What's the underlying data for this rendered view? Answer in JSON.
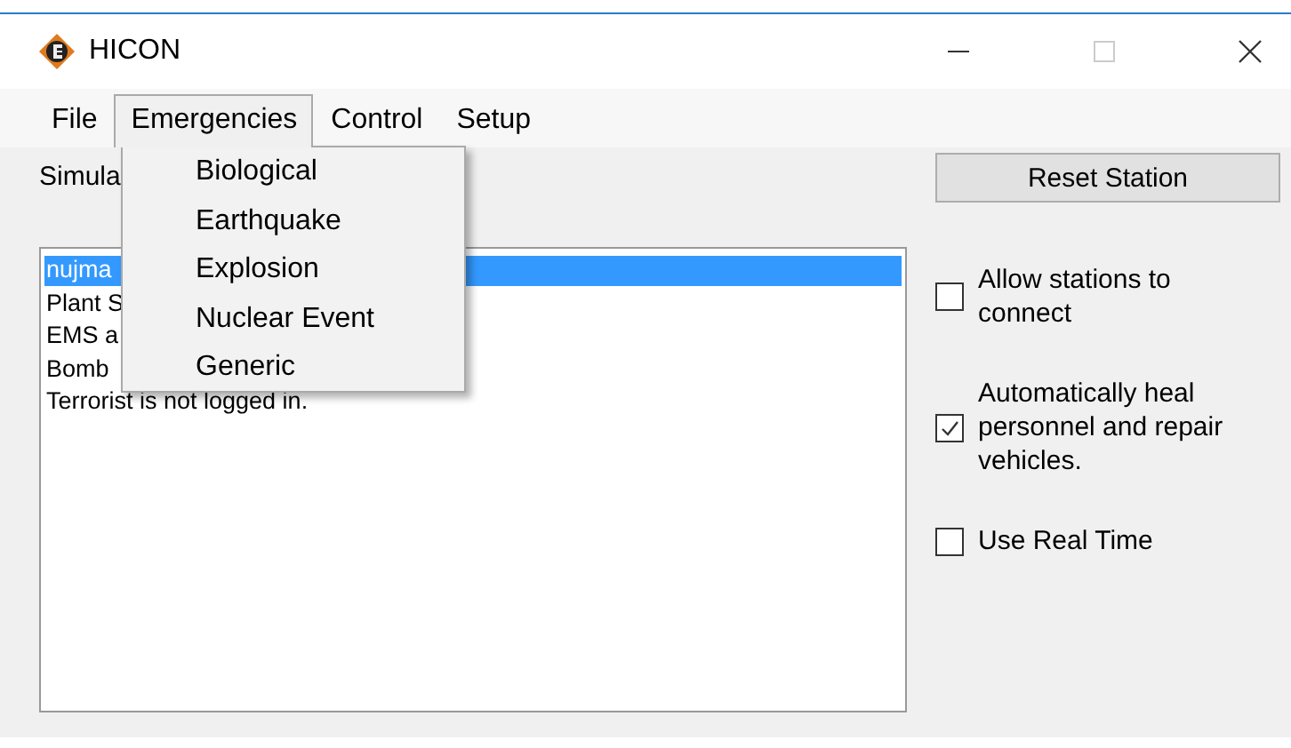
{
  "window": {
    "title": "HICON"
  },
  "menu": [
    {
      "label": "File",
      "selected": false
    },
    {
      "label": "Emergencies",
      "selected": true
    },
    {
      "label": "Control",
      "selected": false
    },
    {
      "label": "Setup",
      "selected": false
    }
  ],
  "open_menu": {
    "items": [
      "Biological",
      "Earthquake",
      "Explosion",
      "Nuclear Event",
      "Generic"
    ]
  },
  "status_label": "Simula",
  "log_list": [
    {
      "text": "nujma",
      "selected": true
    },
    {
      "text": "Plant S",
      "selected": false
    },
    {
      "text": "EMS a",
      "selected": false
    },
    {
      "text": "Bomb",
      "selected": false
    },
    {
      "text": "Terrorist is not logged in.",
      "selected": false
    }
  ],
  "reset_button": "Reset Station",
  "options": [
    {
      "label": "Allow stations to connect",
      "checked": false
    },
    {
      "label": "Automatically heal personnel and repair vehicles.",
      "checked": true
    },
    {
      "label": "Use Real Time",
      "checked": false
    }
  ]
}
